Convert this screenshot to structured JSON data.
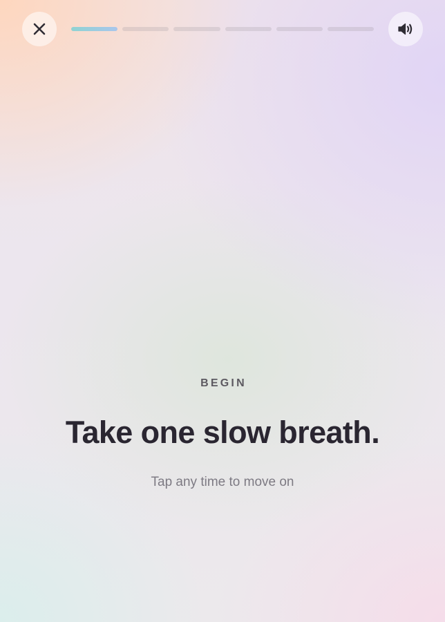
{
  "header": {
    "close_icon": "close-icon",
    "sound_icon": "speaker-volume-icon",
    "progress": {
      "total_steps": 6,
      "current_step": 1,
      "steps": [
        {
          "fill": 1.0
        },
        {
          "fill": 0.0
        },
        {
          "fill": 0.0
        },
        {
          "fill": 0.0
        },
        {
          "fill": 0.0
        },
        {
          "fill": 0.0
        }
      ]
    }
  },
  "main": {
    "eyebrow": "BEGIN",
    "title": "Take one slow breath.",
    "hint": "Tap any time to move on"
  },
  "colors": {
    "progress_active_start": "#8fd3d2",
    "progress_active_end": "#a9c6ec",
    "icon": "#2f2c34",
    "title": "#2a2631",
    "eyebrow": "#5d5a61",
    "hint": "#7d7a83"
  }
}
